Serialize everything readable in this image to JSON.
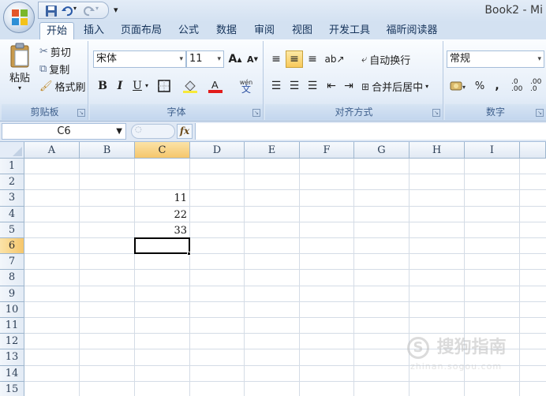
{
  "window": {
    "title": "Book2 - Mi"
  },
  "ribbon_tabs": [
    "开始",
    "插入",
    "页面布局",
    "公式",
    "数据",
    "审阅",
    "视图",
    "开发工具",
    "福昕阅读器"
  ],
  "clipboard": {
    "paste": "粘贴",
    "cut": "剪切",
    "copy": "复制",
    "format_painter": "格式刷",
    "label": "剪贴板"
  },
  "font": {
    "name": "宋体",
    "size": "11",
    "bold": "B",
    "italic": "I",
    "underline": "U",
    "label": "字体",
    "wen": "wén"
  },
  "alignment": {
    "wrap_text": "自动换行",
    "merge_center": "合并后居中",
    "label": "对齐方式"
  },
  "number": {
    "format": "常规",
    "percent": "%",
    "comma": ",",
    "label": "数字",
    "inc_decimal": ".0 .00",
    "dec_decimal": ".00 .0"
  },
  "formula_bar": {
    "name_box": "C6",
    "fx": "fx",
    "formula": ""
  },
  "grid": {
    "columns": [
      "A",
      "B",
      "C",
      "D",
      "E",
      "F",
      "G",
      "H",
      "I"
    ],
    "rows": [
      "1",
      "2",
      "3",
      "4",
      "5",
      "6",
      "7",
      "8",
      "9",
      "10",
      "11",
      "12",
      "13",
      "14",
      "15"
    ],
    "selected_column": "C",
    "selected_row": "6",
    "cells": {
      "C3": "11",
      "C4": "22",
      "C5": "33"
    }
  },
  "watermark": {
    "text": "搜狗指南",
    "sub": "zhinan.sogou.com"
  },
  "colors": {
    "accent": "#2b579a",
    "selection": "#f5c66b"
  }
}
